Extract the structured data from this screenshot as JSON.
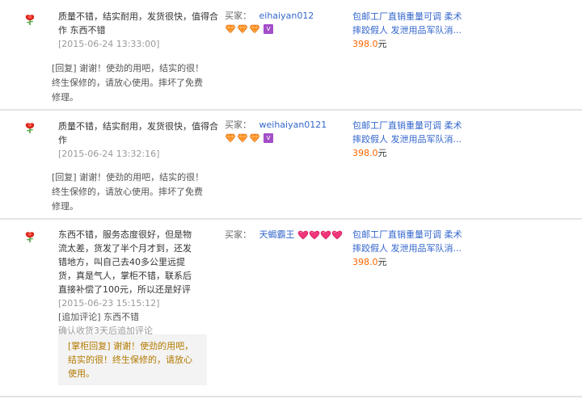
{
  "reviews": [
    {
      "content": "质量不错，结实耐用，发货很快，值得合作 东西不错",
      "date": "[2015-06-24 13:33:00]",
      "reply": "[回复] 谢谢！使劲的用吧，结实的很！终生保修的，请放心使用。摔坏了免费修理。",
      "buyer_label": "买家：",
      "buyer_name": "eihaiyan012",
      "buyer_rank_icon": "diamond-icon",
      "buyer_rank_count": 3,
      "product": "包邮工厂直销重量可调 柔术摔跤假人 发泄用品军队消...",
      "price": "398.0",
      "currency": "元"
    },
    {
      "content": "质量不错，结实耐用，发货很快，值得合作",
      "date": "[2015-06-24 13:32:16]",
      "reply": "[回复] 谢谢！使劲的用吧，结实的很！终生保修的，请放心使用。摔坏了免费修理。",
      "buyer_label": "买家：",
      "buyer_name": "weihaiyan0121",
      "buyer_rank_icon": "diamond-icon",
      "buyer_rank_count": 3,
      "product": "包邮工厂直销重量可调 柔术摔跤假人 发泄用品军队消...",
      "price": "398.0",
      "currency": "元"
    },
    {
      "content": "东西不错，服务态度很好，但是物流太差，货发了半个月才到，还发错地方，叫自己去40多公里远提货，真是气人，掌柜不错，联系后直接补偿了100元，所以还是好评",
      "date": "[2015-06-23 15:15:12]",
      "append_label": "[追加评论] 东西不错",
      "append_note": "确认收货3天后追加评论",
      "reply": "[掌柜回复] 谢谢！使劲的用吧，结实的很！终生保修的，请放心使用。",
      "buyer_label": "买家：",
      "buyer_name": "天蝎霸王",
      "buyer_rank_icon": "heart-icon",
      "buyer_rank_count": 4,
      "product": "包邮工厂直销重量可调 柔术摔跤假人 发泄用品军队消...",
      "price": "398.0",
      "currency": "元"
    }
  ],
  "colors": {
    "link": "#3366cc",
    "price": "#ff6600",
    "seller_reply": "#b37a00",
    "muted": "#999999"
  }
}
